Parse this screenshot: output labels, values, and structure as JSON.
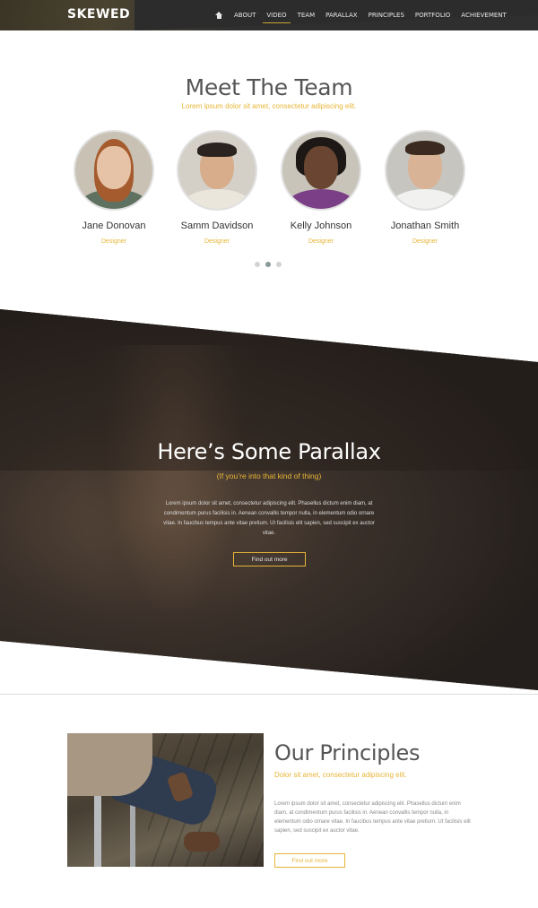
{
  "navbar": {
    "brand": "SKEWED",
    "items": [
      "ABOUT",
      "VIDEO",
      "TEAM",
      "PARALLAX",
      "PRINCIPLES",
      "PORTFOLIO",
      "ACHIEVEMENT"
    ],
    "active_item": "VIDEO",
    "home_icon": "home-icon"
  },
  "team": {
    "title": "Meet The Team",
    "subtitle": "Lorem ipsum dolor sit amet, consectetur adipiscing elit.",
    "members": [
      {
        "name": "Jane Donovan",
        "role": "Designer"
      },
      {
        "name": "Samm Davidson",
        "role": "Designer"
      },
      {
        "name": "Kelly Johnson",
        "role": "Designer"
      },
      {
        "name": "Jonathan Smith",
        "role": "Designer"
      }
    ],
    "carousel": {
      "pages": 3,
      "active": 2
    }
  },
  "parallax": {
    "title": "Here’s Some Parallax",
    "subtitle": "(If you’re into that kind of thing)",
    "body": "Lorem ipsum dolor sit amet, consectetur adipiscing elit. Phasellus dictum enim diam, at condimentum purus facilisis in. Aenean convallis tempor nulla, in elementum odio ornare vitae. In faucibus tempus ante vitae pretium. Ut facilisis elit sapien, sed suscipit ex auctor vitae.",
    "button": "Find out more"
  },
  "principles": {
    "title": "Our Principles",
    "subtitle": "Dolor sit amet, consectetur adipiscing elit.",
    "body": "Lorem ipsum dolor sit amet, consectetur adipiscing elit. Phasellus dictum enim diam, at condimentum purus facilisis in. Aenean convallis tempor nulla, in elementum odio ornare vitae. In faucibus tempus ante vitae pretium. Ut facilisis elit sapien, sed suscipit ex auctor vitae.",
    "button": "Find out more"
  },
  "colors": {
    "accent": "#e7b637",
    "navbar": "#2f2f2f",
    "parallax_bg": "#2a2420"
  }
}
